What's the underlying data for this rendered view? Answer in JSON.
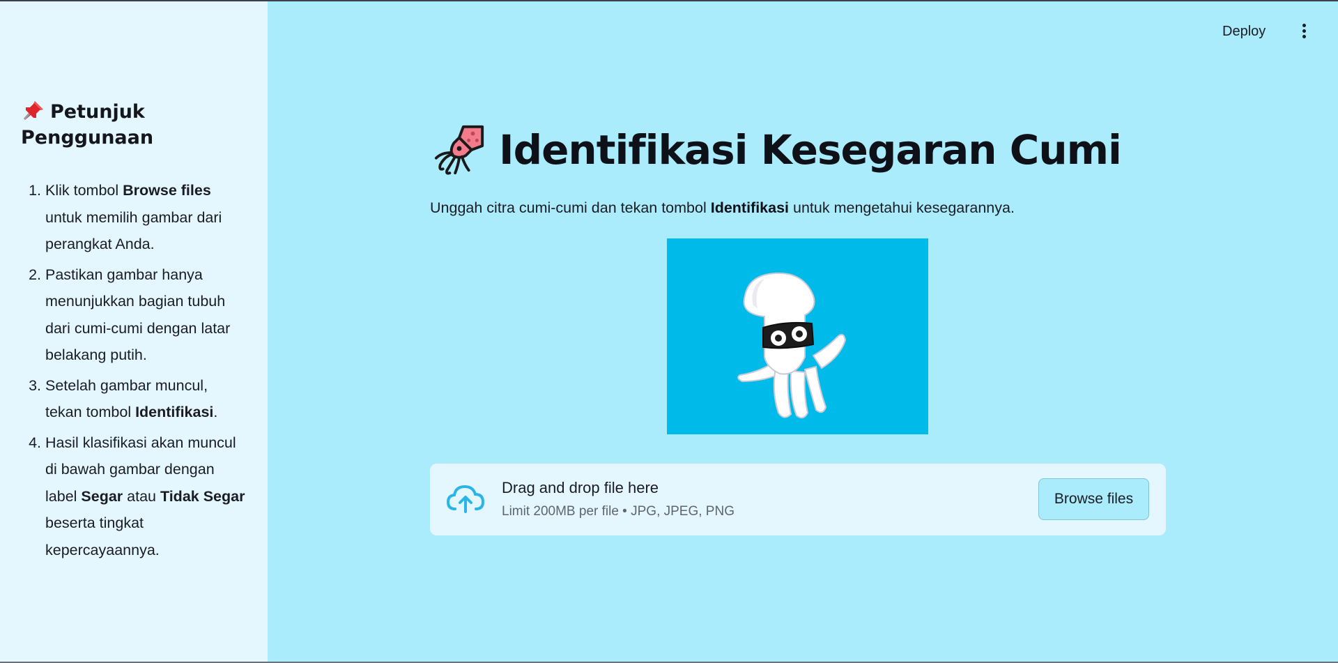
{
  "header": {
    "deploy_label": "Deploy",
    "menu_icon": "vertical-dots-icon"
  },
  "sidebar": {
    "title_icon": "pushpin-icon",
    "title": "Petunjuk Penggunaan",
    "steps": [
      {
        "p1": "Klik tombol ",
        "b1": "Browse files",
        "p2": " untuk memilih gambar dari perangkat Anda."
      },
      {
        "p1": "Pastikan gambar hanya menunjukkan bagian tubuh dari cumi-cumi dengan latar belakang putih."
      },
      {
        "p1": "Setelah gambar muncul, tekan tombol ",
        "b1": "Identifikasi",
        "p2": "."
      },
      {
        "p1": "Hasil klasifikasi akan muncul di bawah gambar dengan label ",
        "b1": "Segar",
        "p2": " atau ",
        "b2": "Tidak Segar",
        "p3": " beserta tingkat kepercayaannya."
      }
    ]
  },
  "main": {
    "title_icon": "squid-icon",
    "title": "Identifikasi Kesegaran Cumi",
    "subtitle_pre": "Unggah citra cumi-cumi dan tekan tombol ",
    "subtitle_bold": "Identifikasi",
    "subtitle_post": " untuk mengetahui kesegarannya.",
    "illustration": "cartoon-squid-illustration"
  },
  "uploader": {
    "icon": "cloud-upload-icon",
    "drag_text": "Drag and drop file here",
    "limit_text": "Limit 200MB per file • JPG, JPEG, PNG",
    "browse_label": "Browse files"
  },
  "colors": {
    "main_bg": "#aaebfc",
    "sidebar_bg": "#e5f7fe",
    "image_bg": "#00bbea",
    "accent": "#29b5e8"
  }
}
